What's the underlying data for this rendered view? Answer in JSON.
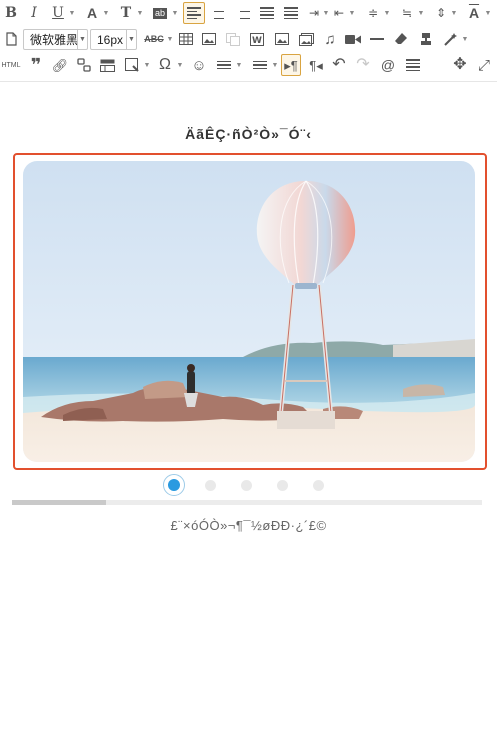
{
  "toolbar": {
    "font_family": "微软雅黑",
    "font_size": "16px",
    "html_label": "HTML",
    "strike_label": "ABC",
    "icons_row1": [
      "bold-icon",
      "italic-icon",
      "underline-icon",
      "font-color-icon",
      "text-style-icon",
      "highlight-icon",
      "align-left-icon",
      "align-center-icon",
      "align-right-icon",
      "align-justify-icon",
      "justify-all-icon",
      "indent-icon",
      "outdent-icon",
      "line-height-icon",
      "paragraph-spacing-icon",
      "row-spacing-icon",
      "clear-format-icon"
    ],
    "icons_row2": [
      "new-document-icon",
      "table-icon",
      "image-icon",
      "copy-icon",
      "word-icon",
      "picture-icon",
      "gallery-icon",
      "music-icon",
      "video-icon",
      "horizontal-rule-icon",
      "eraser-icon",
      "format-brush-icon",
      "magic-wand-icon"
    ],
    "icons_row3": [
      "quote-icon",
      "link-icon",
      "unlink-icon",
      "template-icon",
      "background-icon",
      "special-char-icon",
      "emoji-icon",
      "ordered-list-icon",
      "unordered-list-icon",
      "ltr-icon",
      "rtl-icon",
      "undo-icon",
      "redo-icon",
      "search-replace-icon",
      "preview-icon",
      "move-icon",
      "fullscreen-icon"
    ]
  },
  "editor": {
    "title": "ÄãÊÇ·ñÒ²Ò»¯Ó¨‹",
    "caption": "£¨×óÓÒ»¬¶¯½øÐÐ·¿´£©",
    "slider": {
      "dot_count": 5,
      "active_index": 0,
      "progress_fraction": 0.2
    }
  },
  "colors": {
    "accent": "#e2502e",
    "active_dot": "#2a9ae0",
    "toolbar_active": "#d9a441"
  }
}
